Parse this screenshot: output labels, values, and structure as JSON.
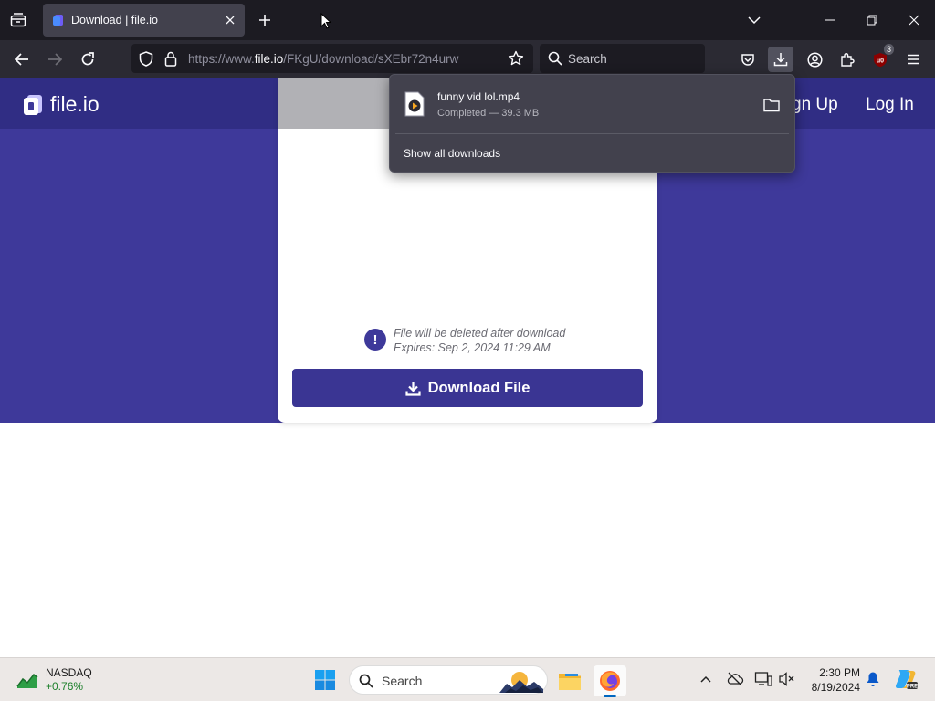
{
  "browser": {
    "tab": {
      "title": "Download | file.io"
    },
    "url": {
      "prefix": "https://www.",
      "host": "file.io",
      "path": "/FKgU/download/sXEbr72n4urw"
    },
    "search_placeholder": "Search",
    "ublock_count": "3"
  },
  "downloads_panel": {
    "file_name": "funny vid lol.mp4",
    "status": "Completed — 39.3 MB",
    "show_all": "Show all downloads"
  },
  "site": {
    "logo_text": "file.io",
    "signup": "gn Up",
    "login": "Log In",
    "notice_line1": "File will be deleted after download",
    "notice_line2": "Expires: Sep 2, 2024 11:29 AM",
    "download_button": "Download File",
    "colors": {
      "brand": "#3e399a",
      "header": "#302d84",
      "button": "#3a3593"
    }
  },
  "taskbar": {
    "widget_name": "NASDAQ",
    "widget_change": "+0.76%",
    "search_placeholder": "Search",
    "time": "2:30 PM",
    "date": "8/19/2024"
  }
}
